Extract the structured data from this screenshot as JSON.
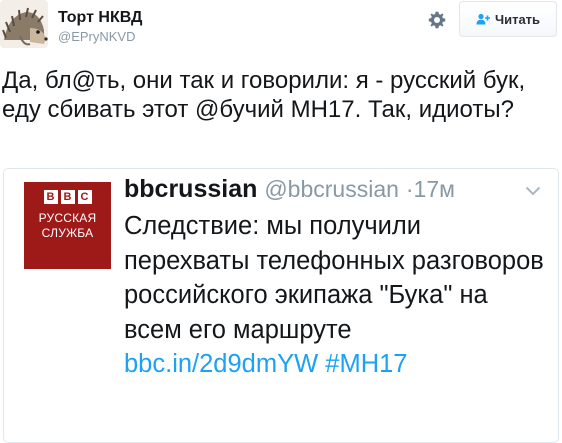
{
  "author": {
    "display_name": "Торт НКВД",
    "handle": "@EPryNKVD",
    "avatar_icon": "hedgehog-avatar"
  },
  "header": {
    "settings_icon": "gear-icon",
    "follow_label": "Читать",
    "follow_icon": "add-user-icon"
  },
  "tweet": {
    "text": "Да, бл@ть, они так и говорили: я - русский бук, еду сбивать этот @бучий  МН17. Так, идиоты?"
  },
  "quoted": {
    "logo": {
      "letters": [
        "B",
        "B",
        "C"
      ],
      "line1": "РУССКАЯ",
      "line2": "СЛУЖБА",
      "color": "#9e1a18"
    },
    "name": "bbcrussian",
    "handle": "@bbcrussian",
    "separator": "·",
    "time": "17м",
    "text": "Следствие: мы получили перехваты телефонных разговоров российского экипажа \"Бука\" на всем его маршруте ",
    "link": "bbc.in/2d9dmYW",
    "hashtag": "#MH17",
    "caret_icon": "chevron-down-icon"
  },
  "colors": {
    "text": "#14171a",
    "secondary": "#8899a6",
    "link": "#1da1f2",
    "border": "#e1e8ed"
  }
}
